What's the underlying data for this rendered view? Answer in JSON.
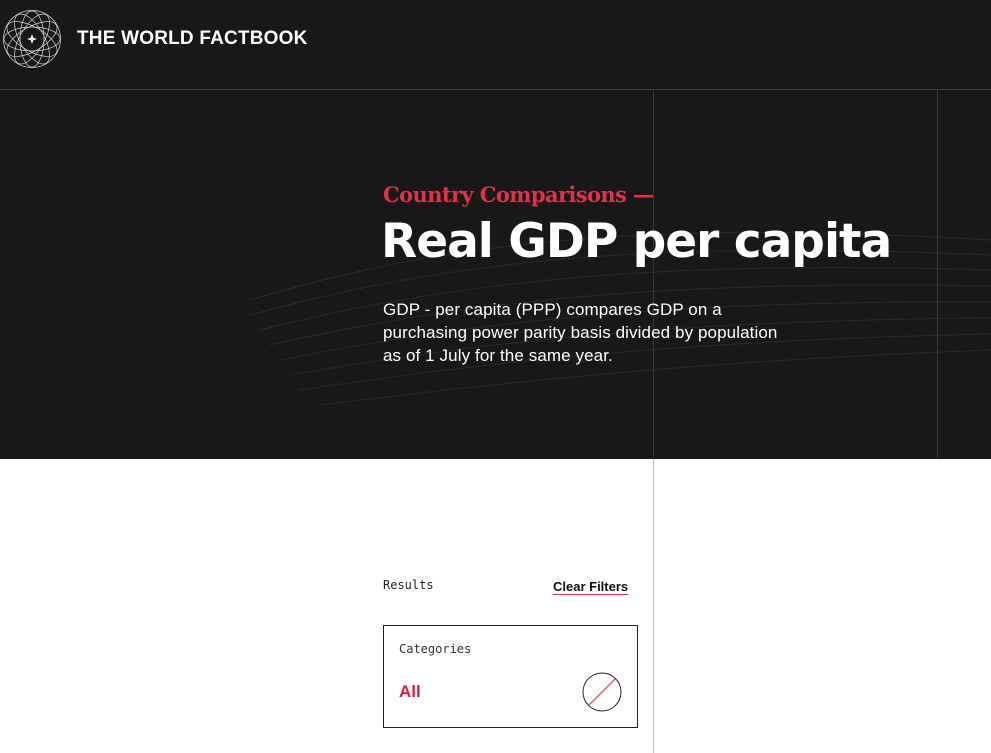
{
  "header": {
    "site_title": "THE WORLD FACTBOOK",
    "logo_icon": "globe-orbit-star-icon"
  },
  "hero": {
    "eyebrow": "Country Comparisons —",
    "title": "Real GDP per capita",
    "description": "GDP - per capita (PPP) compares GDP on a purchasing power parity basis divided by population as of 1 July for the same year."
  },
  "results": {
    "label": "Results",
    "clear_filters": "Clear Filters",
    "categories": {
      "label": "Categories",
      "value": "All",
      "toggle_icon": "no-filter-slash-circle-icon"
    }
  },
  "colors": {
    "header_bg": "#18181a",
    "accent_red": "#e0334a",
    "text_light": "#ffffff",
    "text_dark": "#111111",
    "divider": "#bdbdbd"
  }
}
